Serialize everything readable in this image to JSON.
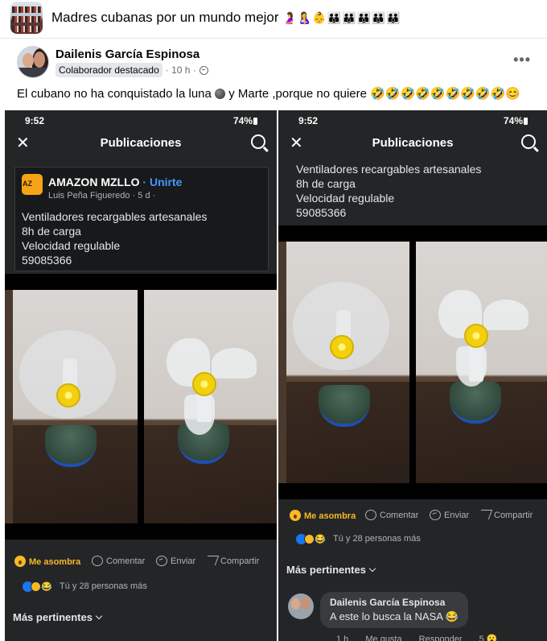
{
  "group": {
    "title": "Madres cubanas por un mundo mejor",
    "title_emojis": "🤰🤱👶👪👪👪👪👪"
  },
  "post": {
    "author": "Dailenis García Espinosa",
    "badge": "Colaborador destacado",
    "time": "· 10 h ·",
    "more": "•••",
    "text_before": "El cubano no ha conquistado la luna ",
    "text_after": " y Marte ,porque no quiere 🤣🤣🤣🤣🤣🤣🤣🤣🤣😊"
  },
  "phone": {
    "time": "9:52",
    "battery": "74%",
    "signal": "⁂◢",
    "close": "✕",
    "title": "Publicaciones"
  },
  "shared_post": {
    "page_name": "AMAZON MZLLO",
    "join": "· Unirte",
    "sub": "Luis Peña Figueredo · 5 d ·",
    "lines": [
      "Ventiladores recargables artesanales",
      "8h de carga",
      "Velocidad regulable",
      "59085366"
    ]
  },
  "actions": {
    "wow": "Me asombra",
    "comment": "Comentar",
    "send": "Enviar",
    "share": "Compartir"
  },
  "reactions_summary": {
    "emoji": "😂",
    "text": "Tú y 28 personas más"
  },
  "relevant": "Más pertinentes",
  "comment": {
    "author": "Dailenis García Espinosa",
    "text": "A este lo busca la NASA 😂",
    "actions": [
      "1 h",
      "Me gusta",
      "Responder",
      "5 😮"
    ]
  }
}
